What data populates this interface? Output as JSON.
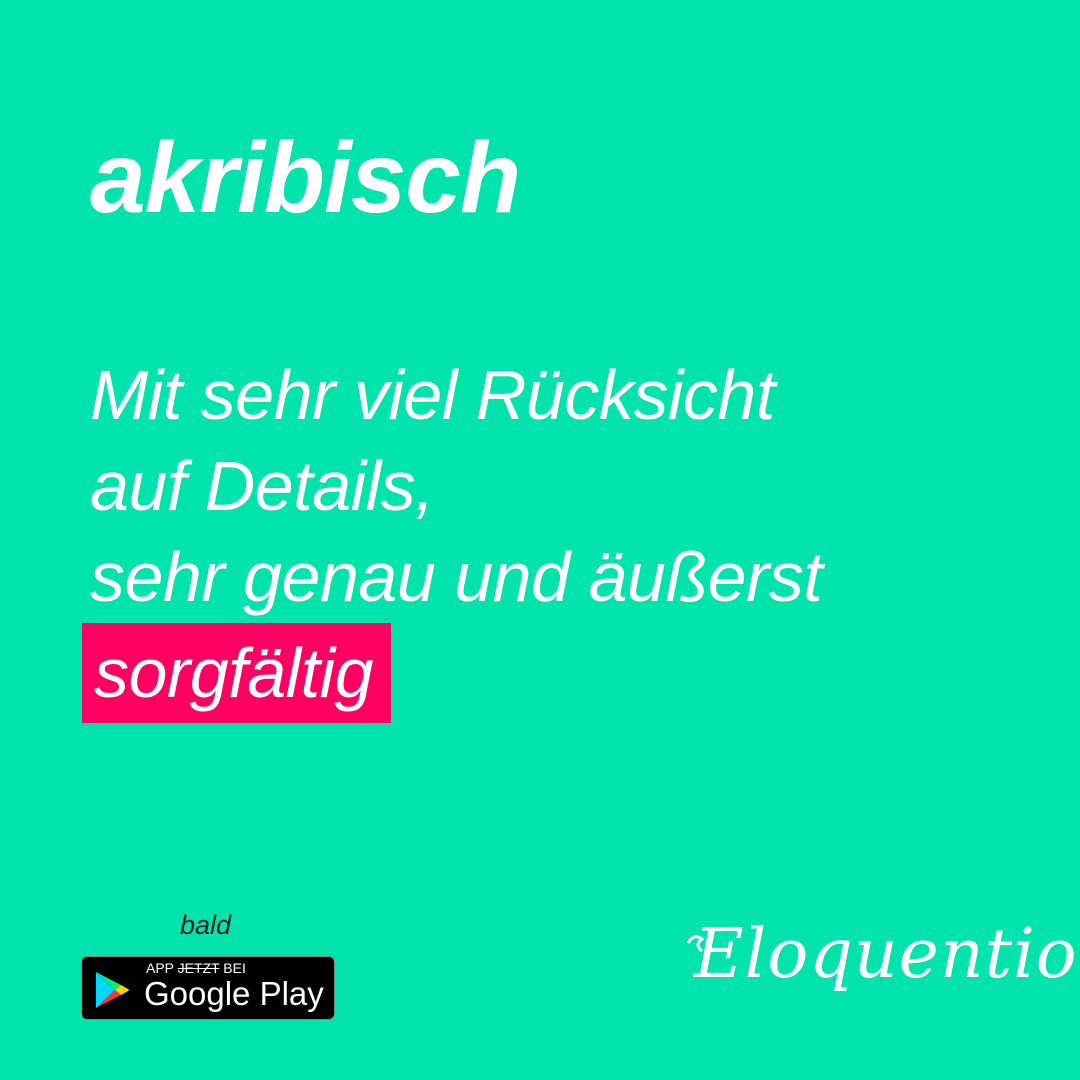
{
  "word": "akribisch",
  "definition": {
    "lines": [
      "Mit sehr viel Rücksicht",
      "auf Details,",
      "sehr genau und äußerst"
    ],
    "highlight": "sorgfältig"
  },
  "availability": {
    "prefix": "bald",
    "badge_top_app": "APP",
    "badge_top_struck": "JETZT",
    "badge_top_bei": "BEI",
    "store_name": "Google Play"
  },
  "brand": "Eloquention",
  "colors": {
    "background": "#00E3AC",
    "highlight": "#FF0062",
    "text": "#FFFFFF"
  },
  "icons": [
    "google-play-icon"
  ]
}
